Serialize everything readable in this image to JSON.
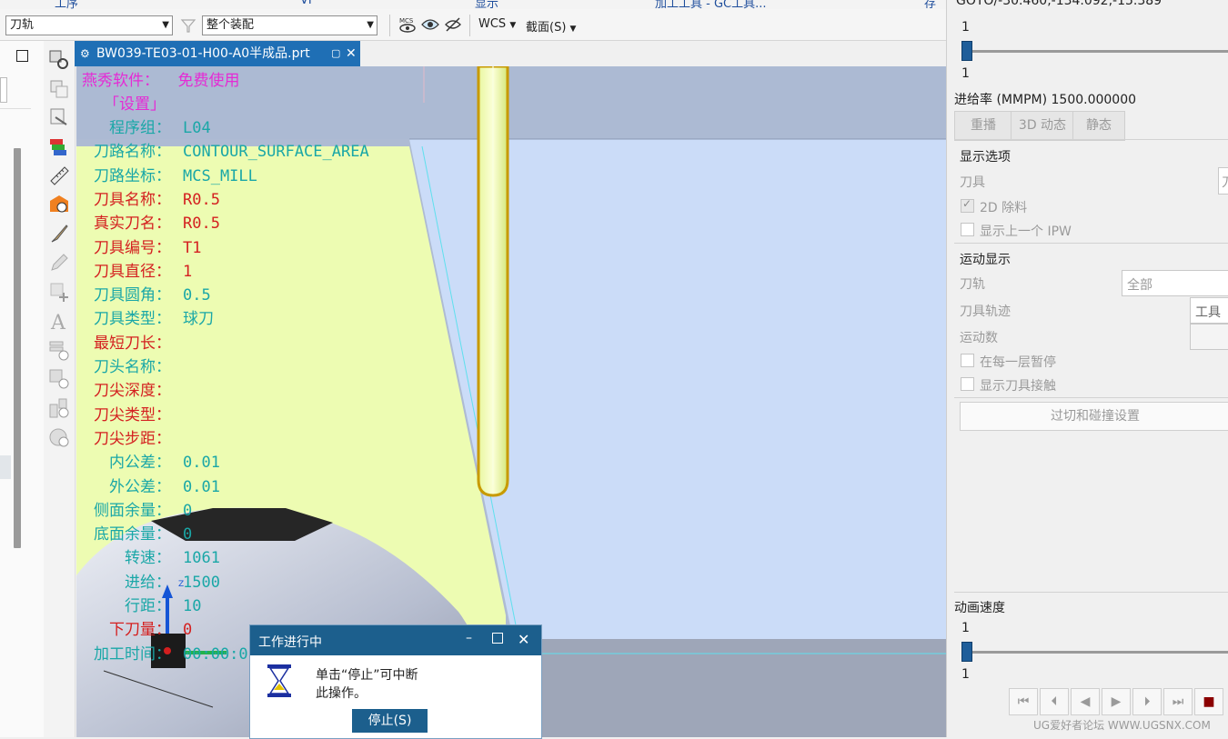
{
  "top_menu": [
    "工序",
    "VI",
    "显示",
    "加工工具 - GC工具...",
    "存"
  ],
  "toolbar": {
    "filter_select": "刀轨",
    "scope_select": "整个装配",
    "wcs_label": "WCS",
    "section_label": "截面(S)"
  },
  "tab": {
    "title": "BW039-TE03-01-H00-A0半成品.prt"
  },
  "overlay": {
    "line1": "燕秀软件：  免费使用",
    "line2": "「设置」",
    "rows": [
      {
        "label": "程序组：",
        "value": "L04",
        "color": "#1aa7a7"
      },
      {
        "label": "刀路名称：",
        "value": "CONTOUR_SURFACE_AREA",
        "color": "#1aa7a7"
      },
      {
        "label": "刀路坐标：",
        "value": "MCS_MILL",
        "color": "#1aa7a7"
      },
      {
        "label": "刀具名称：",
        "value": "R0.5",
        "color": "#d42020"
      },
      {
        "label": "真实刀名：",
        "value": "R0.5",
        "color": "#d42020"
      },
      {
        "label": "刀具编号：",
        "value": "T1",
        "color": "#d42020"
      },
      {
        "label": "刀具直径：",
        "value": "1",
        "color": "#d42020"
      },
      {
        "label": "刀具圆角：",
        "value": "0.5",
        "color": "#1aa7a7"
      },
      {
        "label": "刀具类型：",
        "value": "球刀",
        "color": "#1aa7a7"
      },
      {
        "label": "最短刀长：",
        "value": "",
        "color": "#d42020"
      },
      {
        "label": "刀头名称：",
        "value": "",
        "color": "#1aa7a7"
      },
      {
        "label": "刀尖深度：",
        "value": "",
        "color": "#d42020"
      },
      {
        "label": "刀尖类型：",
        "value": "",
        "color": "#d42020"
      },
      {
        "label": "刀尖步距：",
        "value": "",
        "color": "#d42020"
      },
      {
        "label": "内公差：",
        "value": "0.01",
        "color": "#1aa7a7"
      },
      {
        "label": "外公差：",
        "value": "0.01",
        "color": "#1aa7a7"
      },
      {
        "label": "侧面余量：",
        "value": "0",
        "color": "#1aa7a7"
      },
      {
        "label": "底面余量：",
        "value": "0",
        "color": "#1aa7a7"
      },
      {
        "label": "转速：",
        "value": "1061",
        "color": "#1aa7a7"
      },
      {
        "label": "进给：",
        "value": "1500",
        "color": "#1aa7a7"
      },
      {
        "label": "行距：",
        "value": "10",
        "color": "#1aa7a7"
      },
      {
        "label": "下刀量：",
        "value": "0",
        "color": "#d42020"
      },
      {
        "label": "加工时间：",
        "value": "00:00:0",
        "color": "#1aa7a7"
      }
    ],
    "axis_label": "Z"
  },
  "dialog": {
    "title": "工作进行中",
    "message1": "单击“停止”可中断",
    "message2": "此操作。",
    "stop_button": "停止(S)"
  },
  "right_panel": {
    "goto_text": "GOTO/-30.460,-134.092,-15.389",
    "slider1_top": "1",
    "slider1_bottom": "1",
    "feed_rate": "进给率 (MMPM) 1500.000000",
    "tabs": [
      "重播",
      "3D 动态",
      "静态"
    ],
    "display_options": "显示选项",
    "tool_label": "刀具",
    "tool_value": "刀",
    "check_2d": "2D 除料",
    "check_ipw": "显示上一个 IPW",
    "motion_display": "运动显示",
    "path_label": "刀轨",
    "path_value": "全部",
    "trace_label": "刀具轨迹",
    "trace_value": "工具",
    "motion_count_label": "运动数",
    "check_pause": "在每一层暂停",
    "check_contact": "显示刀具接触",
    "gouge_button": "过切和碰撞设置",
    "anim_speed": "动画速度",
    "slider2_top": "1",
    "slider2_bottom": "1",
    "state": {
      "check_2d_checked": true,
      "slider1_position": 0.0,
      "slider2_position": 0.0
    }
  },
  "watermark": "UG爱好者论坛 WWW.UGSNX.COM"
}
